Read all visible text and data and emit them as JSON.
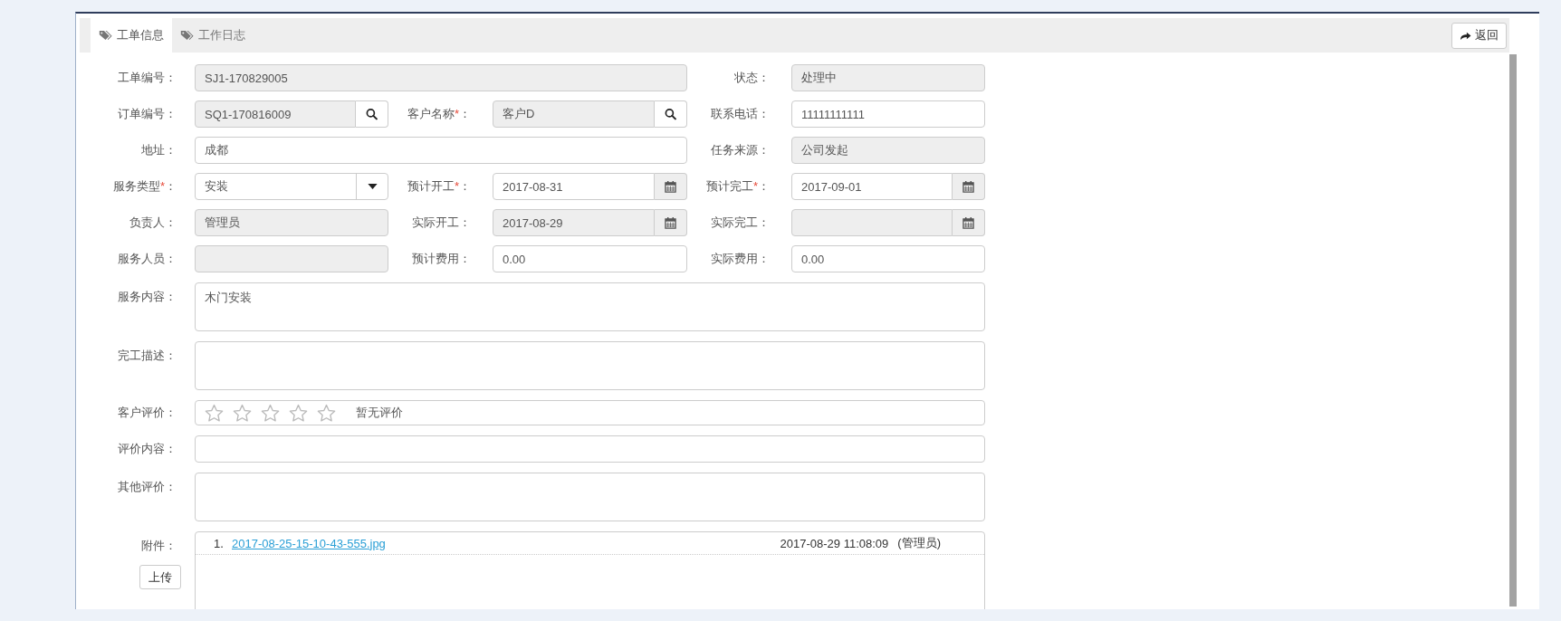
{
  "tabs": [
    {
      "label": "工单信息",
      "selected": true
    },
    {
      "label": "工作日志",
      "selected": false
    }
  ],
  "back_button": "返回",
  "rows": [
    {
      "fields": [
        {
          "kind": "text",
          "label": "工单编号",
          "colon": "：",
          "value": "SJ1-170829005",
          "readonly": true
        },
        {
          "kind": "text",
          "label": "状态",
          "colon": "：",
          "value": "处理中",
          "readonly": true
        }
      ]
    },
    {
      "fields": [
        {
          "kind": "search",
          "label": "订单编号",
          "colon": "：",
          "value": "SQ1-170816009",
          "readonly": true
        },
        {
          "kind": "search",
          "label": "客户名称",
          "mark": "*",
          "colon": "：",
          "value": "客户D",
          "readonly": true
        },
        {
          "kind": "text",
          "label": "联系电话",
          "colon": "：",
          "value": "11111111111",
          "readonly": false
        }
      ]
    },
    {
      "fields": [
        {
          "kind": "text",
          "label": "地址",
          "colon": "：",
          "value": "成都",
          "readonly": false
        },
        {
          "kind": "text",
          "label": "任务来源",
          "colon": "：",
          "value": "公司发起",
          "readonly": true
        }
      ]
    },
    {
      "fields": [
        {
          "kind": "select",
          "label": "服务类型",
          "mark": "*",
          "colon": "：",
          "value": "安装",
          "readonly": false
        },
        {
          "kind": "date",
          "label": "预计开工",
          "mark": "*",
          "colon": "：",
          "value": "2017-08-31",
          "readonly": false
        },
        {
          "kind": "date",
          "label": "预计完工",
          "mark": "*",
          "colon": "：",
          "value": "2017-09-01",
          "readonly": false
        }
      ]
    },
    {
      "fields": [
        {
          "kind": "text",
          "label": "负责人",
          "colon": "：",
          "value": "管理员",
          "readonly": true
        },
        {
          "kind": "date",
          "label": "实际开工",
          "colon": "：",
          "value": "2017-08-29",
          "readonly": true
        },
        {
          "kind": "date",
          "label": "实际完工",
          "colon": "：",
          "readonly": true
        }
      ]
    },
    {
      "fields": [
        {
          "kind": "text",
          "label": "服务人员",
          "colon": "：",
          "readonly": true
        },
        {
          "kind": "text",
          "label": "预计费用",
          "colon": "：",
          "value": "0.00",
          "readonly": false
        },
        {
          "kind": "text",
          "label": "实际费用",
          "colon": "：",
          "value": "0.00",
          "readonly": false
        }
      ]
    },
    {
      "fields": [
        {
          "kind": "textarea",
          "label": "服务内容",
          "colon": "：",
          "value": "木门安装",
          "readonly": false
        }
      ]
    },
    {
      "fields": [
        {
          "kind": "textarea",
          "label": "完工描述",
          "colon": "：",
          "readonly": false
        }
      ]
    },
    {
      "fields": [
        {
          "kind": "rating",
          "label": "客户评价",
          "colon": "：",
          "stars": 0,
          "text": "暂无评价"
        }
      ]
    },
    {
      "fields": [
        {
          "kind": "text",
          "label": "评价内容",
          "colon": "：",
          "readonly": false
        }
      ]
    },
    {
      "fields": [
        {
          "kind": "textarea",
          "label": "其他评价",
          "colon": "：",
          "readonly": false
        }
      ]
    },
    {
      "fields": [
        {
          "kind": "attachments",
          "label": "附件",
          "colon": "：",
          "upload_button": "上传",
          "items": [
            {
              "index": "1.",
              "name": "2017-08-25-15-10-43-555.jpg",
              "time": "2017-08-29 11:08:09",
              "user": "(管理员)"
            }
          ]
        }
      ]
    }
  ]
}
